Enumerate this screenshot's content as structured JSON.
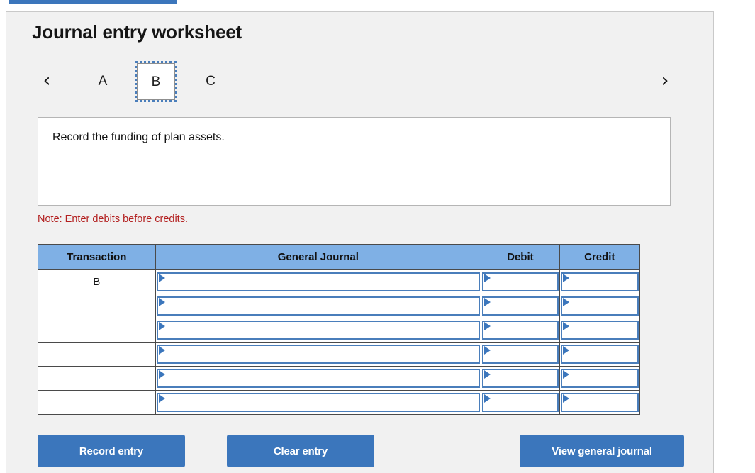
{
  "page": {
    "title": "Journal entry worksheet",
    "note": "Note: Enter debits before credits.",
    "description": "Record the funding of plan assets."
  },
  "colors": {
    "accent_blue": "#3b76bc",
    "header_blue": "#7fb0e5",
    "note_red": "#b32020",
    "panel_grey": "#f1f1f1"
  },
  "tabstrip": {
    "prev_icon": "‹",
    "next_icon": "›",
    "tabs": [
      {
        "label": "A",
        "selected": false
      },
      {
        "label": "B",
        "selected": true
      },
      {
        "label": "C",
        "selected": false
      }
    ]
  },
  "table": {
    "headers": [
      "Transaction",
      "General Journal",
      "Debit",
      "Credit"
    ],
    "rows": [
      {
        "transaction": "B",
        "general_journal": "",
        "debit": "",
        "credit": ""
      },
      {
        "transaction": "",
        "general_journal": "",
        "debit": "",
        "credit": ""
      },
      {
        "transaction": "",
        "general_journal": "",
        "debit": "",
        "credit": ""
      },
      {
        "transaction": "",
        "general_journal": "",
        "debit": "",
        "credit": ""
      },
      {
        "transaction": "",
        "general_journal": "",
        "debit": "",
        "credit": ""
      },
      {
        "transaction": "",
        "general_journal": "",
        "debit": "",
        "credit": ""
      }
    ]
  },
  "buttons": {
    "record": "Record entry",
    "clear": "Clear entry",
    "view": "View general journal"
  }
}
